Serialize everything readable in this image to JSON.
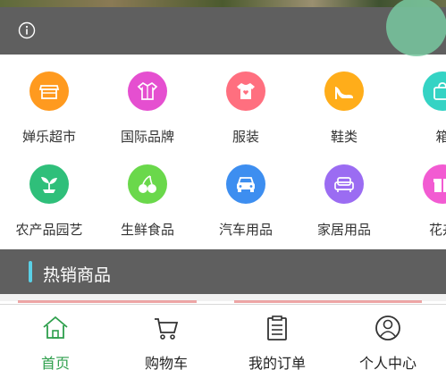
{
  "banner": {
    "icon": "info-icon"
  },
  "categories": [
    {
      "label": "婵乐超市",
      "icon": "store-icon",
      "color": "#ff9a1f"
    },
    {
      "label": "国际品牌",
      "icon": "shirt-icon",
      "color": "#e54fd0"
    },
    {
      "label": "服装",
      "icon": "tshirt-heart-icon",
      "color": "#ff6f7f"
    },
    {
      "label": "鞋类",
      "icon": "high-heel-icon",
      "color": "#ffad1a"
    },
    {
      "label": "箱",
      "icon": "bag-icon",
      "color": "#34d3c4"
    },
    {
      "label": "农产品园艺",
      "icon": "sprout-icon",
      "color": "#2fbf7a"
    },
    {
      "label": "生鲜食品",
      "icon": "cherry-icon",
      "color": "#6ad84b"
    },
    {
      "label": "汽车用品",
      "icon": "car-icon",
      "color": "#3d8ef0"
    },
    {
      "label": "家居用品",
      "icon": "sofa-icon",
      "color": "#9b6cf2"
    },
    {
      "label": "花卉",
      "icon": "gift-icon",
      "color": "#f25bd2"
    }
  ],
  "hot_section": {
    "title": "热销商品",
    "accent": "#5ad0e6"
  },
  "tabbar": {
    "active_color": "#2e9f4c",
    "tabs": [
      {
        "label": "首页",
        "icon": "home-icon",
        "active": true
      },
      {
        "label": "购物车",
        "icon": "cart-icon",
        "active": false
      },
      {
        "label": "我的订单",
        "icon": "order-list-icon",
        "active": false
      },
      {
        "label": "个人中心",
        "icon": "user-icon",
        "active": false
      }
    ]
  }
}
